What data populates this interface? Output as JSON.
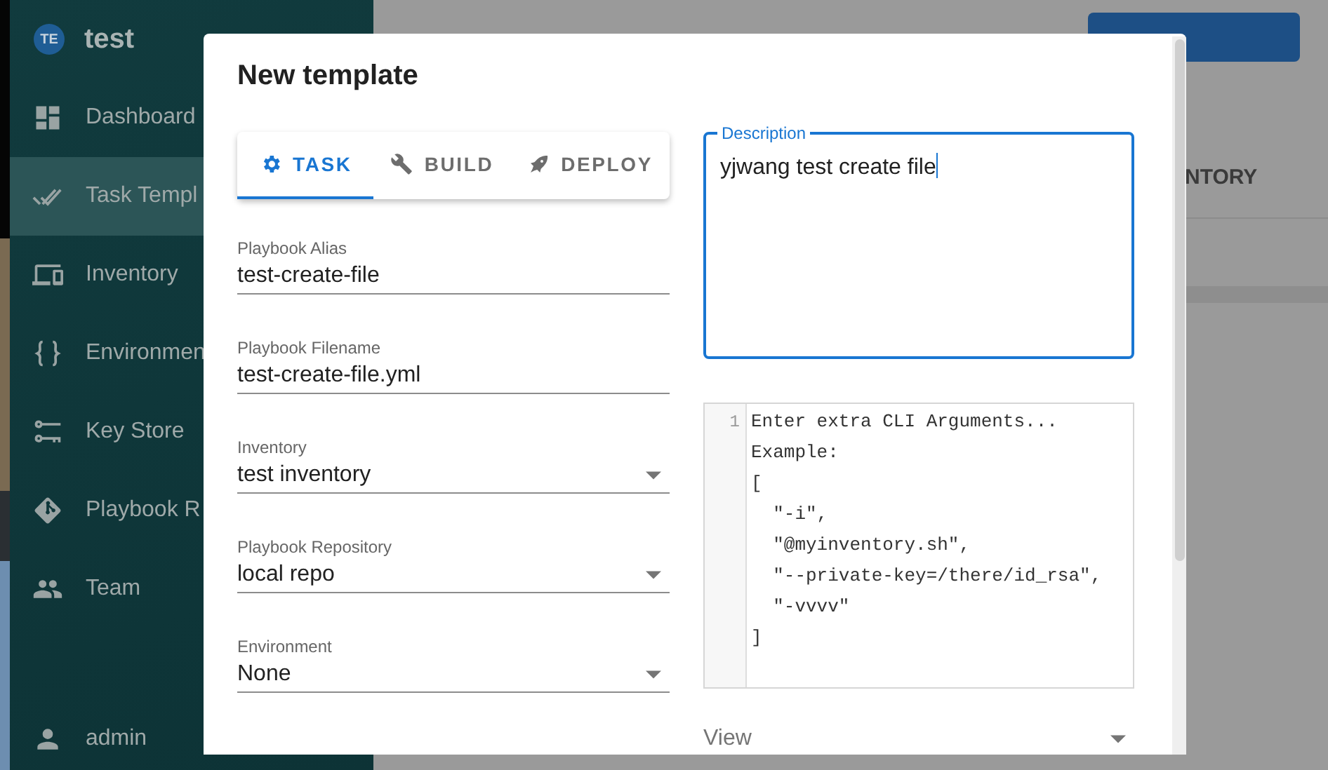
{
  "sidebar": {
    "avatar": "TE",
    "team": "test",
    "items": [
      {
        "label": "Dashboard",
        "selected": false
      },
      {
        "label": "Task Templ",
        "selected": true
      },
      {
        "label": "Inventory",
        "selected": false
      },
      {
        "label": "Environmen",
        "selected": false
      },
      {
        "label": "Key Store",
        "selected": false
      },
      {
        "label": "Playbook R",
        "selected": false
      },
      {
        "label": "Team",
        "selected": false
      }
    ],
    "user": "admin"
  },
  "page": {
    "tabs": [
      "NTORY"
    ]
  },
  "dialog": {
    "title": "New template",
    "tabs": [
      {
        "label": "TASK",
        "selected": true
      },
      {
        "label": "BUILD",
        "selected": false
      },
      {
        "label": "DEPLOY",
        "selected": false
      }
    ],
    "fields": [
      {
        "kind": "text",
        "label": "Playbook Alias",
        "value": "test-create-file"
      },
      {
        "kind": "text",
        "label": "Playbook Filename",
        "value": "test-create-file.yml"
      },
      {
        "kind": "select",
        "label": "Inventory",
        "value": "test inventory"
      },
      {
        "kind": "select",
        "label": "Playbook Repository",
        "value": "local repo"
      },
      {
        "kind": "select",
        "label": "Environment",
        "value": "None"
      }
    ],
    "description": {
      "label": "Description",
      "value": "yjwang test create file",
      "focused": true
    },
    "cli_args": {
      "line_number": "1",
      "placeholder_lines": [
        "Enter extra CLI Arguments...",
        "Example:",
        "[",
        "  \"-i\",",
        "  \"@myinventory.sh\",",
        "  \"--private-key=/there/id_rsa\",",
        "  \"-vvvv\"",
        "]"
      ]
    },
    "view": {
      "label": "View"
    }
  }
}
